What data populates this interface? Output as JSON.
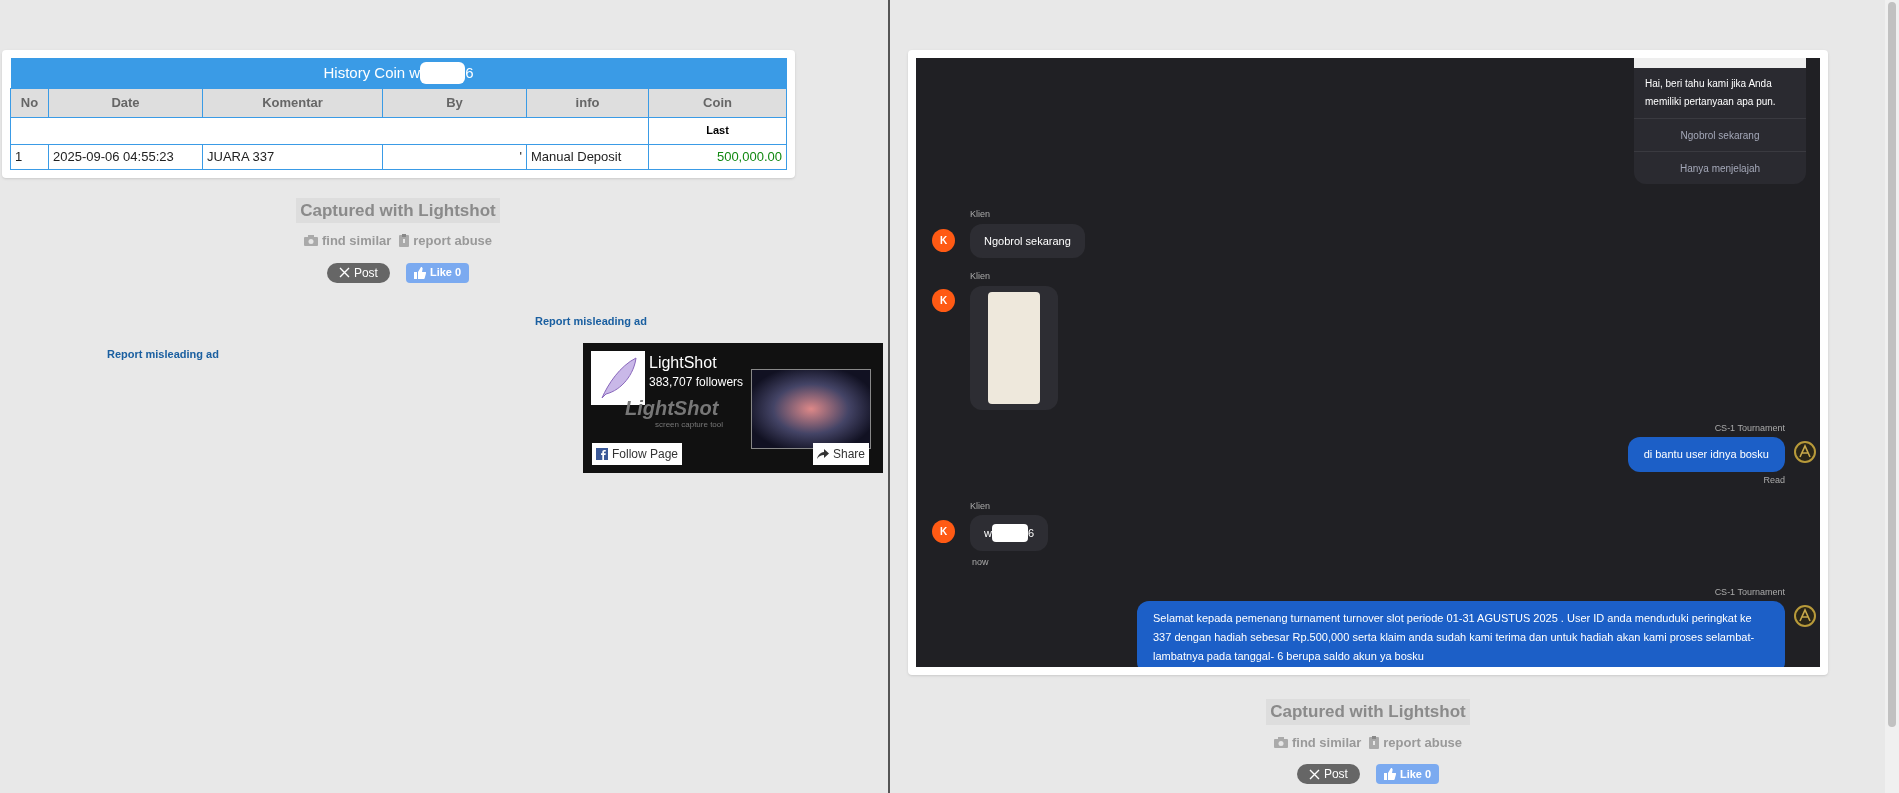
{
  "left": {
    "table": {
      "title_start": "History Coin w",
      "title_end": "6",
      "columns": [
        "No",
        "Date",
        "Komentar",
        "By",
        "info",
        "Coin"
      ],
      "subheader": "Last",
      "rows": [
        {
          "no": "1",
          "date": "2025-09-06 04:55:23",
          "komentar": "JUARA 337",
          "by": "'",
          "info": "Manual Deposit",
          "coin": "500,000.00"
        }
      ]
    },
    "captured": "Captured with Lightshot",
    "find_similar": "find similar",
    "report_abuse": "report abuse",
    "post": "Post",
    "like": "Like 0",
    "report_ads": [
      "Report misleading ad",
      "Report misleading ad"
    ],
    "fb_widget": {
      "name": "LightShot",
      "followers": "383,707 followers",
      "logo_text": "LightShot",
      "tagline": "screen capture tool",
      "follow": "Follow Page",
      "share": "Share"
    }
  },
  "right": {
    "chat": {
      "welcome": {
        "text": "Hai, beri tahu kami jika Anda memiliki pertanyaan apa pun.",
        "options": [
          "Ngobrol sekarang",
          "Hanya menjelajah"
        ]
      },
      "messages": [
        {
          "kind": "client",
          "sender": "Klien",
          "avatar": "K",
          "text": "Ngobrol sekarang"
        },
        {
          "kind": "client_image",
          "sender": "Klien",
          "avatar": "K"
        },
        {
          "kind": "agent",
          "sender": "CS-1 Tournament",
          "text": "di bantu user idnya bosku",
          "status": "Read"
        },
        {
          "kind": "client_redacted",
          "sender": "Klien",
          "avatar": "K",
          "text_start": "w",
          "text_end": "6",
          "status": "now"
        },
        {
          "kind": "agent",
          "sender": "CS-1 Tournament",
          "text": "Selamat kepada pemenang turnament turnover slot periode 01-31 AGUSTUS 2025 . User ID anda menduduki peringkat ke 337 dengan hadiah sebesar Rp.500,000 serta klaim anda sudah kami terima dan untuk hadiah akan kami proses selambat-lambatnya pada tanggal- 6 berupa saldo akun ya bosku"
        }
      ]
    },
    "captured": "Captured with Lightshot",
    "find_similar": "find similar",
    "report_abuse": "report abuse",
    "post": "Post",
    "like": "Like 0"
  }
}
